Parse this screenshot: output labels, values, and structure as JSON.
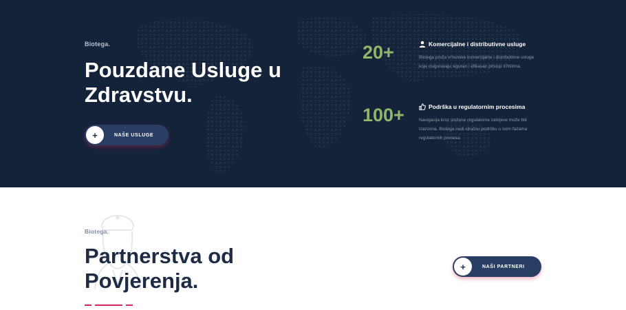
{
  "hero": {
    "brand": "Biotega.",
    "title": "Pouzdane Usluge u Zdravstvu.",
    "cta_label": "NAŠE USLUGE",
    "cta_icon": "plus-icon",
    "stats": [
      {
        "number": "20+",
        "icon": "user-icon",
        "heading": "Komercijalne i distributivne usluge",
        "text": "Biotega pruža vrhunske komercijalne i distributivne usluge koje osiguravaju siguran i efikasan pristup tržištima."
      },
      {
        "number": "100+",
        "icon": "thumbs-up-icon",
        "heading": "Podrška u regulatornim procesima",
        "text": "Navigacija kroz složene regulatorne zahtjeve može biti izazovna. Biotega nudi stručnu podršku u svim fazama regulatornih procesa."
      }
    ]
  },
  "partners": {
    "brand": "Biotega.",
    "title": "Partnerstva od Povjerenja.",
    "cta_label": "NAŠI PARTNERI",
    "cta_icon": "plus-icon"
  },
  "colors": {
    "hero_bg": "#15233a",
    "accent_green": "#8fb66a",
    "button_bg": "#283f63",
    "underline_pink": "#d0275c",
    "title_dark": "#1d2b44"
  }
}
